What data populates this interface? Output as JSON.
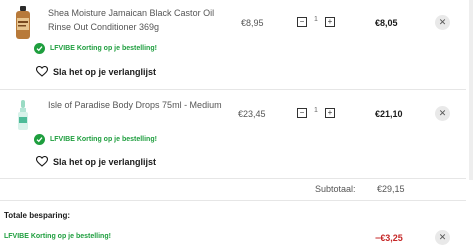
{
  "cart": {
    "items": [
      {
        "name": "Shea Moisture Jamaican Black Castor Oil Rinse Out Conditioner 369g",
        "unit_price": "€8,95",
        "quantity": "1",
        "total": "€8,05",
        "discount": "LFVIBE Korting op je bestelling!",
        "wishlist": "Sla het op je verlanglijst"
      },
      {
        "name": "Isle of Paradise Body Drops 75ml - Medium",
        "unit_price": "€23,45",
        "quantity": "1",
        "total": "€21,10",
        "discount": "LFVIBE Korting op je bestelling!",
        "wishlist": "Sla het op je verlanglijst"
      }
    ],
    "decrease_symbol": "−",
    "increase_symbol": "+",
    "remove_symbol": "✕"
  },
  "summary": {
    "subtotal_label": "Subtotaal:",
    "subtotal_value": "€29,15",
    "savings_title": "Totale besparing:",
    "savings_label": "LFVIBE Korting op je bestelling!",
    "savings_value": "−€3,25"
  },
  "colors": {
    "discount_green": "#1e9e3e",
    "savings_red": "#c62828"
  },
  "icons": {
    "check": "check-circle-icon",
    "heart": "heart-outline-icon",
    "remove": "close-icon"
  }
}
